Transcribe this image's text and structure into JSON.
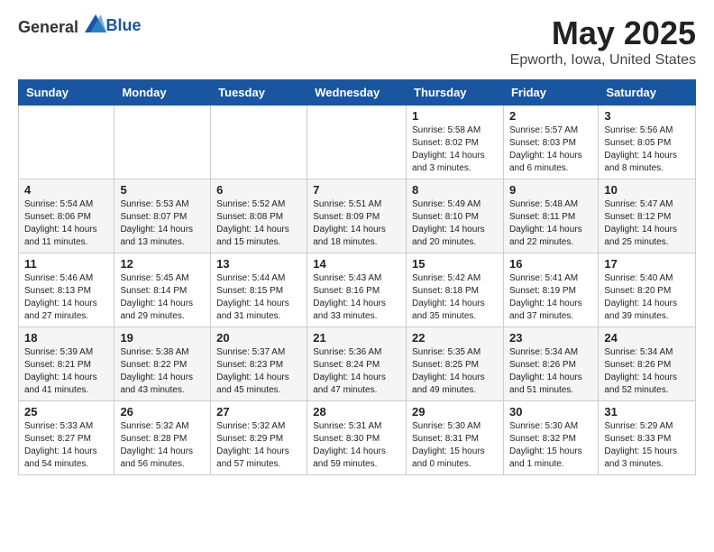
{
  "logo": {
    "general": "General",
    "blue": "Blue"
  },
  "header": {
    "title": "May 2025",
    "subtitle": "Epworth, Iowa, United States"
  },
  "days_of_week": [
    "Sunday",
    "Monday",
    "Tuesday",
    "Wednesday",
    "Thursday",
    "Friday",
    "Saturday"
  ],
  "weeks": [
    [
      {
        "day": "",
        "info": ""
      },
      {
        "day": "",
        "info": ""
      },
      {
        "day": "",
        "info": ""
      },
      {
        "day": "",
        "info": ""
      },
      {
        "day": "1",
        "info": "Sunrise: 5:58 AM\nSunset: 8:02 PM\nDaylight: 14 hours and 3 minutes."
      },
      {
        "day": "2",
        "info": "Sunrise: 5:57 AM\nSunset: 8:03 PM\nDaylight: 14 hours and 6 minutes."
      },
      {
        "day": "3",
        "info": "Sunrise: 5:56 AM\nSunset: 8:05 PM\nDaylight: 14 hours and 8 minutes."
      }
    ],
    [
      {
        "day": "4",
        "info": "Sunrise: 5:54 AM\nSunset: 8:06 PM\nDaylight: 14 hours and 11 minutes."
      },
      {
        "day": "5",
        "info": "Sunrise: 5:53 AM\nSunset: 8:07 PM\nDaylight: 14 hours and 13 minutes."
      },
      {
        "day": "6",
        "info": "Sunrise: 5:52 AM\nSunset: 8:08 PM\nDaylight: 14 hours and 15 minutes."
      },
      {
        "day": "7",
        "info": "Sunrise: 5:51 AM\nSunset: 8:09 PM\nDaylight: 14 hours and 18 minutes."
      },
      {
        "day": "8",
        "info": "Sunrise: 5:49 AM\nSunset: 8:10 PM\nDaylight: 14 hours and 20 minutes."
      },
      {
        "day": "9",
        "info": "Sunrise: 5:48 AM\nSunset: 8:11 PM\nDaylight: 14 hours and 22 minutes."
      },
      {
        "day": "10",
        "info": "Sunrise: 5:47 AM\nSunset: 8:12 PM\nDaylight: 14 hours and 25 minutes."
      }
    ],
    [
      {
        "day": "11",
        "info": "Sunrise: 5:46 AM\nSunset: 8:13 PM\nDaylight: 14 hours and 27 minutes."
      },
      {
        "day": "12",
        "info": "Sunrise: 5:45 AM\nSunset: 8:14 PM\nDaylight: 14 hours and 29 minutes."
      },
      {
        "day": "13",
        "info": "Sunrise: 5:44 AM\nSunset: 8:15 PM\nDaylight: 14 hours and 31 minutes."
      },
      {
        "day": "14",
        "info": "Sunrise: 5:43 AM\nSunset: 8:16 PM\nDaylight: 14 hours and 33 minutes."
      },
      {
        "day": "15",
        "info": "Sunrise: 5:42 AM\nSunset: 8:18 PM\nDaylight: 14 hours and 35 minutes."
      },
      {
        "day": "16",
        "info": "Sunrise: 5:41 AM\nSunset: 8:19 PM\nDaylight: 14 hours and 37 minutes."
      },
      {
        "day": "17",
        "info": "Sunrise: 5:40 AM\nSunset: 8:20 PM\nDaylight: 14 hours and 39 minutes."
      }
    ],
    [
      {
        "day": "18",
        "info": "Sunrise: 5:39 AM\nSunset: 8:21 PM\nDaylight: 14 hours and 41 minutes."
      },
      {
        "day": "19",
        "info": "Sunrise: 5:38 AM\nSunset: 8:22 PM\nDaylight: 14 hours and 43 minutes."
      },
      {
        "day": "20",
        "info": "Sunrise: 5:37 AM\nSunset: 8:23 PM\nDaylight: 14 hours and 45 minutes."
      },
      {
        "day": "21",
        "info": "Sunrise: 5:36 AM\nSunset: 8:24 PM\nDaylight: 14 hours and 47 minutes."
      },
      {
        "day": "22",
        "info": "Sunrise: 5:35 AM\nSunset: 8:25 PM\nDaylight: 14 hours and 49 minutes."
      },
      {
        "day": "23",
        "info": "Sunrise: 5:34 AM\nSunset: 8:26 PM\nDaylight: 14 hours and 51 minutes."
      },
      {
        "day": "24",
        "info": "Sunrise: 5:34 AM\nSunset: 8:26 PM\nDaylight: 14 hours and 52 minutes."
      }
    ],
    [
      {
        "day": "25",
        "info": "Sunrise: 5:33 AM\nSunset: 8:27 PM\nDaylight: 14 hours and 54 minutes."
      },
      {
        "day": "26",
        "info": "Sunrise: 5:32 AM\nSunset: 8:28 PM\nDaylight: 14 hours and 56 minutes."
      },
      {
        "day": "27",
        "info": "Sunrise: 5:32 AM\nSunset: 8:29 PM\nDaylight: 14 hours and 57 minutes."
      },
      {
        "day": "28",
        "info": "Sunrise: 5:31 AM\nSunset: 8:30 PM\nDaylight: 14 hours and 59 minutes."
      },
      {
        "day": "29",
        "info": "Sunrise: 5:30 AM\nSunset: 8:31 PM\nDaylight: 15 hours and 0 minutes."
      },
      {
        "day": "30",
        "info": "Sunrise: 5:30 AM\nSunset: 8:32 PM\nDaylight: 15 hours and 1 minute."
      },
      {
        "day": "31",
        "info": "Sunrise: 5:29 AM\nSunset: 8:33 PM\nDaylight: 15 hours and 3 minutes."
      }
    ]
  ]
}
